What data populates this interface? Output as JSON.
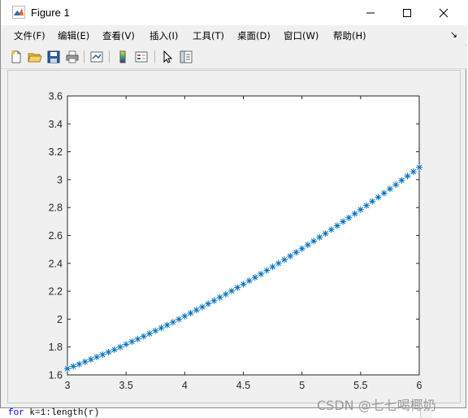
{
  "window": {
    "title": "Figure 1"
  },
  "window_controls": {
    "minimize": "—",
    "maximize": "☐",
    "close": "✕"
  },
  "menubar": {
    "items": [
      "文件(F)",
      "编辑(E)",
      "查看(V)",
      "插入(I)",
      "工具(T)",
      "桌面(D)",
      "窗口(W)",
      "帮助(H)"
    ],
    "overflow_arrow": "↘"
  },
  "toolbar": {
    "icons": [
      "new-figure-icon",
      "open-file-icon",
      "save-icon",
      "print-icon",
      "link-plot-icon",
      "colorbar-icon",
      "legend-icon",
      "pointer-icon",
      "property-editor-icon"
    ]
  },
  "chart_data": {
    "type": "scatter",
    "marker": "*",
    "color": "#0072bd",
    "xlim": [
      3,
      6
    ],
    "ylim": [
      1.6,
      3.6
    ],
    "xticks": [
      "3",
      "3.5",
      "4",
      "4.5",
      "5",
      "5.5",
      "6"
    ],
    "yticks": [
      "1.6",
      "1.8",
      "2",
      "2.2",
      "2.4",
      "2.6",
      "2.8",
      "3",
      "3.2",
      "3.4",
      "3.6"
    ],
    "x": [
      3.0,
      3.05,
      3.1,
      3.15,
      3.2,
      3.25,
      3.3,
      3.35,
      3.4,
      3.45,
      3.5,
      3.55,
      3.6,
      3.65,
      3.7,
      3.75,
      3.8,
      3.85,
      3.9,
      3.95,
      4.0,
      4.05,
      4.1,
      4.15,
      4.2,
      4.25,
      4.3,
      4.35,
      4.4,
      4.45,
      4.5,
      4.55,
      4.6,
      4.65,
      4.7,
      4.75,
      4.8,
      4.85,
      4.9,
      4.95,
      5.0,
      5.05,
      5.1,
      5.15,
      5.2,
      5.25,
      5.3,
      5.35,
      5.4,
      5.45,
      5.5,
      5.55,
      5.6,
      5.65,
      5.7,
      5.75,
      5.8,
      5.85,
      5.9,
      5.95,
      6.0
    ],
    "y": [
      1.645,
      1.661,
      1.677,
      1.694,
      1.711,
      1.728,
      1.745,
      1.763,
      1.781,
      1.8,
      1.819,
      1.838,
      1.857,
      1.876,
      1.896,
      1.916,
      1.937,
      1.957,
      1.978,
      1.999,
      2.021,
      2.043,
      2.065,
      2.087,
      2.11,
      2.132,
      2.156,
      2.179,
      2.202,
      2.226,
      2.25,
      2.275,
      2.299,
      2.324,
      2.349,
      2.375,
      2.4,
      2.426,
      2.452,
      2.479,
      2.505,
      2.532,
      2.559,
      2.587,
      2.614,
      2.642,
      2.67,
      2.699,
      2.727,
      2.756,
      2.785,
      2.814,
      2.844,
      2.874,
      2.903,
      2.934,
      2.964,
      2.995,
      3.026,
      3.057,
      3.088
    ],
    "grid": false
  },
  "code": {
    "keyword": "for",
    "rest": " k=1:length(r)"
  },
  "watermark": "CSDN @七七喝椰奶"
}
